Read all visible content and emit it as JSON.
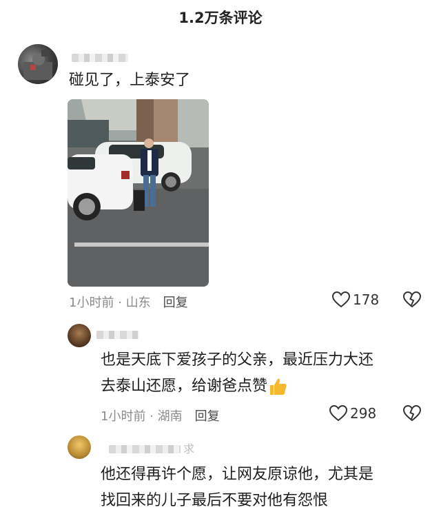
{
  "header": {
    "title": "1.2万条评论"
  },
  "comments": [
    {
      "text": "碰见了，上泰安了",
      "time_location": "1小时前 · 山东",
      "reply_label": "回复",
      "likes": "178",
      "has_photo": true
    },
    {
      "text_line1": "也是天底下爱孩子的父亲，最近压力大还",
      "text_line2": "去泰山还愿，给谢爸点赞",
      "emoji": "thumbs-up",
      "time_location": "1小时前 · 湖南",
      "reply_label": "回复",
      "likes": "298"
    },
    {
      "name_partial": "求",
      "text_line1": "他还得再许个愿，让网友原谅他，尤其是",
      "text_line2": "找回来的儿子最后不要对他有怨恨"
    }
  ],
  "icons": {
    "like": "heart-outline-icon",
    "dislike": "broken-heart-icon",
    "emoji": "thumbs-up-icon"
  },
  "colors": {
    "meta_text": "#8b8b8b",
    "emoji_yellow": "#f5b82e"
  }
}
